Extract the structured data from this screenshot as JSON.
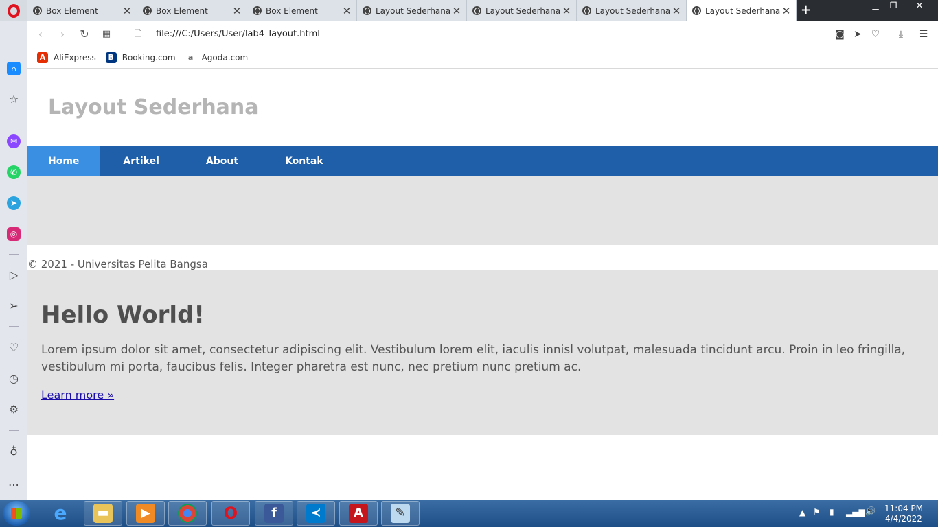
{
  "browser": {
    "tabs": [
      {
        "title": "Box Element",
        "active": false
      },
      {
        "title": "Box Element",
        "active": false
      },
      {
        "title": "Box Element",
        "active": false
      },
      {
        "title": "Layout Sederhana",
        "active": false
      },
      {
        "title": "Layout Sederhana",
        "active": false
      },
      {
        "title": "Layout Sederhana",
        "active": false
      },
      {
        "title": "Layout Sederhana",
        "active": true
      }
    ],
    "url": "file:///C:/Users/User/lab4_layout.html",
    "bookmarks": [
      {
        "label": "AliExpress",
        "icon": "aliexpress-icon",
        "color": "#e62e04"
      },
      {
        "label": "Booking.com",
        "icon": "booking-icon",
        "color": "#003580"
      },
      {
        "label": "Agoda.com",
        "icon": "agoda-icon",
        "color": "#666666"
      }
    ]
  },
  "page": {
    "site_title": "Layout Sederhana",
    "nav": {
      "home": "Home",
      "artikel": "Artikel",
      "about": "About",
      "kontak": "Kontak"
    },
    "footer": "© 2021 - Universitas Pelita Bangsa",
    "content": {
      "heading": "Hello World!",
      "paragraph": "Lorem ipsum dolor sit amet, consectetur adipiscing elit. Vestibulum lorem elit, iaculis innisl volutpat, malesuada tincidunt arcu. Proin in leo fringilla, vestibulum mi porta, faucibus felis. Integer pharetra est nunc, nec pretium nunc pretium ac.",
      "link": "Learn more »"
    },
    "colors": {
      "nav_bg": "#1f5fa9",
      "nav_active": "#3a8fe2",
      "content_bg": "#e3e3e3",
      "title": "#b5b5b5"
    }
  },
  "taskbar": {
    "time": "11:04 PM",
    "date": "4/4/2022"
  }
}
